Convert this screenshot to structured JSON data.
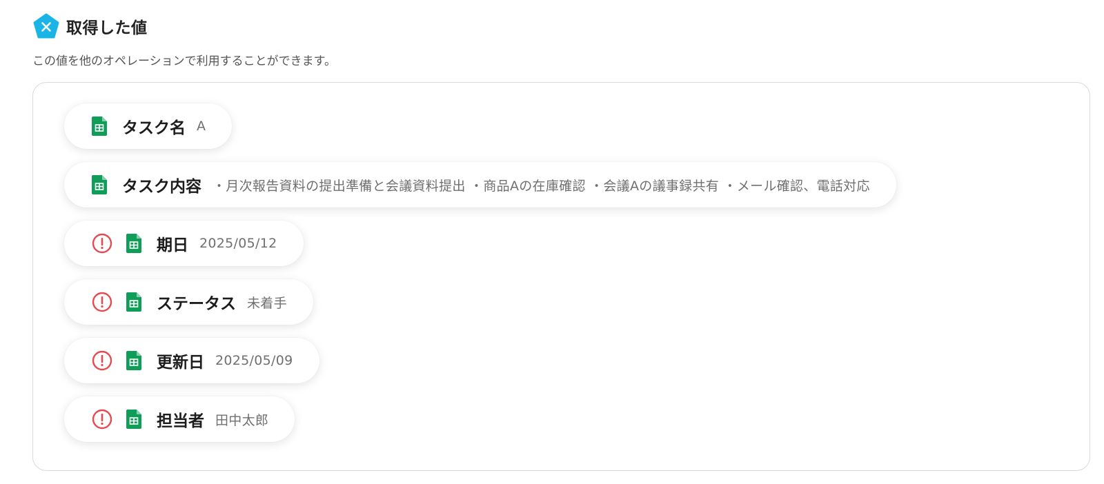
{
  "header": {
    "title": "取得した値",
    "subtitle": "この値を他のオペレーションで利用することができます。",
    "brand_icon": "yoom-pentagon-icon",
    "brand_color": "#1ab4e6"
  },
  "colors": {
    "sheets_green": "#0f9d58",
    "warning_red": "#e64a4f",
    "border": "#d9d9d9"
  },
  "fields": [
    {
      "label": "タスク名",
      "value": "A",
      "icon": "spreadsheet-icon",
      "warning": false
    },
    {
      "label": "タスク内容",
      "value": "・月次報告資料の提出準備と会議資料提出 ・商品Aの在庫確認 ・会議Aの議事録共有 ・メール確認、電話対応",
      "icon": "spreadsheet-icon",
      "warning": false
    },
    {
      "label": "期日",
      "value": "2025/05/12",
      "icon": "spreadsheet-icon",
      "warning": true
    },
    {
      "label": "ステータス",
      "value": "未着手",
      "icon": "spreadsheet-icon",
      "warning": true
    },
    {
      "label": "更新日",
      "value": "2025/05/09",
      "icon": "spreadsheet-icon",
      "warning": true
    },
    {
      "label": "担当者",
      "value": "田中太郎",
      "icon": "spreadsheet-icon",
      "warning": true
    }
  ]
}
